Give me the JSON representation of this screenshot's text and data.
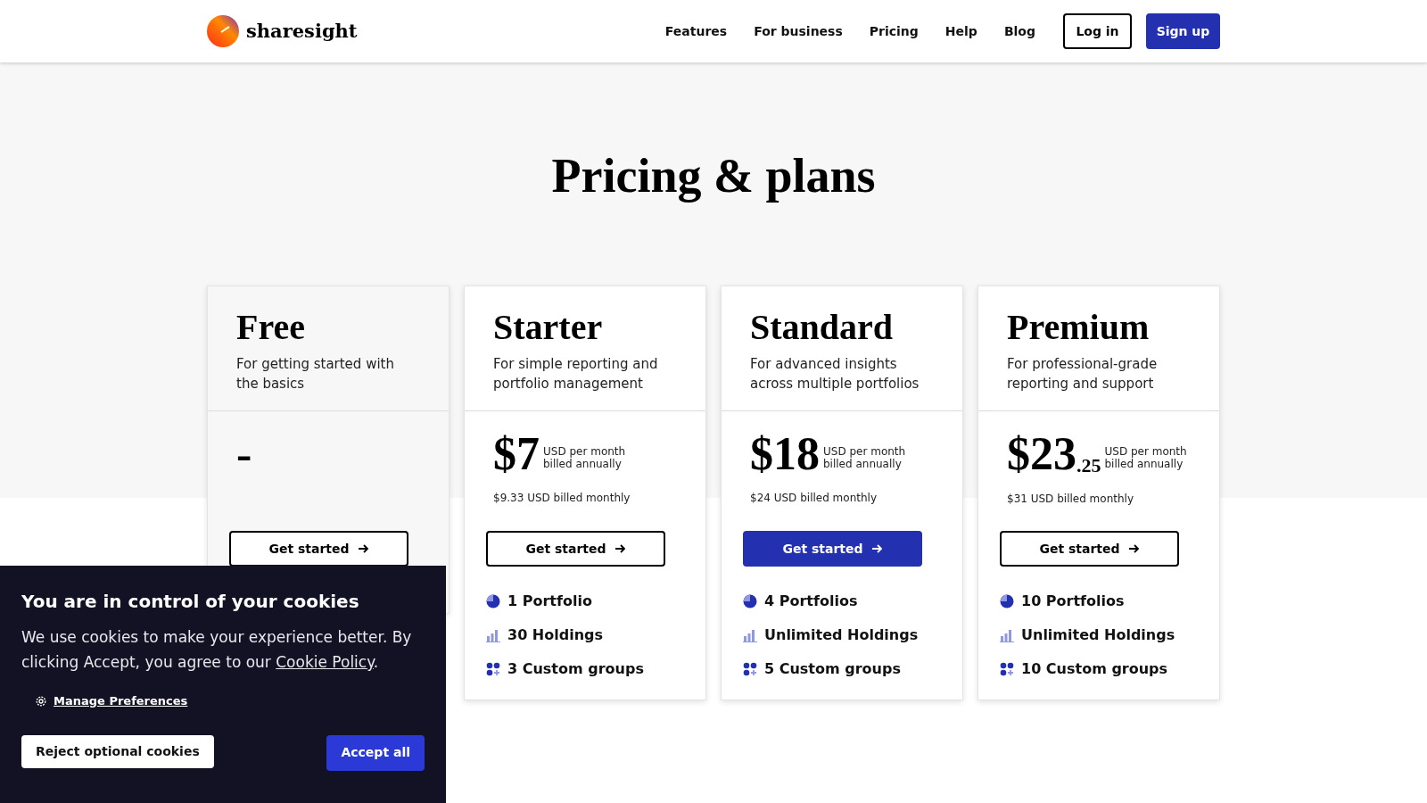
{
  "header": {
    "brand": "sharesight",
    "nav": [
      "Features",
      "For business",
      "Pricing",
      "Help",
      "Blog"
    ],
    "login": "Log in",
    "signup": "Sign up"
  },
  "title": "Pricing & plans",
  "plans": [
    {
      "kind": "free",
      "name": "Free",
      "description": "For getting started with the basics",
      "price": "-",
      "button": "Get started",
      "featured": false
    },
    {
      "kind": "paid",
      "name": "Starter",
      "description": "For simple reporting and portfolio management",
      "price": "$7",
      "period": [
        "USD per month",
        "billed annually"
      ],
      "monthly": "$9.33 USD billed monthly",
      "button": "Get started",
      "featured": false,
      "features": [
        {
          "kind": "portfolio",
          "text": "1 Portfolio"
        },
        {
          "kind": "holdings",
          "text": "30 Holdings"
        },
        {
          "kind": "groups",
          "text": "3 Custom groups"
        }
      ]
    },
    {
      "kind": "paid",
      "name": "Standard",
      "description": "For advanced insights across multiple portfolios",
      "price": "$18",
      "period": [
        "USD per month",
        "billed annually"
      ],
      "monthly": "$24 USD billed monthly",
      "button": "Get started",
      "featured": true,
      "features": [
        {
          "kind": "portfolio",
          "text": "4 Portfolios"
        },
        {
          "kind": "holdings",
          "text": "Unlimited Holdings"
        },
        {
          "kind": "groups",
          "text": "5 Custom groups"
        }
      ]
    },
    {
      "kind": "paid",
      "name": "Premium",
      "description": "For professional-grade reporting and support",
      "price": "$23",
      "cents": ".25",
      "period": [
        "USD per month",
        "billed annually"
      ],
      "monthly": "$31 USD billed monthly",
      "button": "Get started",
      "featured": false,
      "features": [
        {
          "kind": "portfolio",
          "text": "10 Portfolios"
        },
        {
          "kind": "holdings",
          "text": "Unlimited Holdings"
        },
        {
          "kind": "groups",
          "text": "10 Custom groups"
        }
      ]
    }
  ],
  "cookies": {
    "title": "You are in control of your cookies",
    "body": "We use cookies to make your experience better. By clicking Accept, you agree to our ",
    "link": "Cookie Policy",
    "end": ".",
    "manage": "Manage Preferences",
    "reject": "Reject optional cookies",
    "accept": "Accept all"
  }
}
